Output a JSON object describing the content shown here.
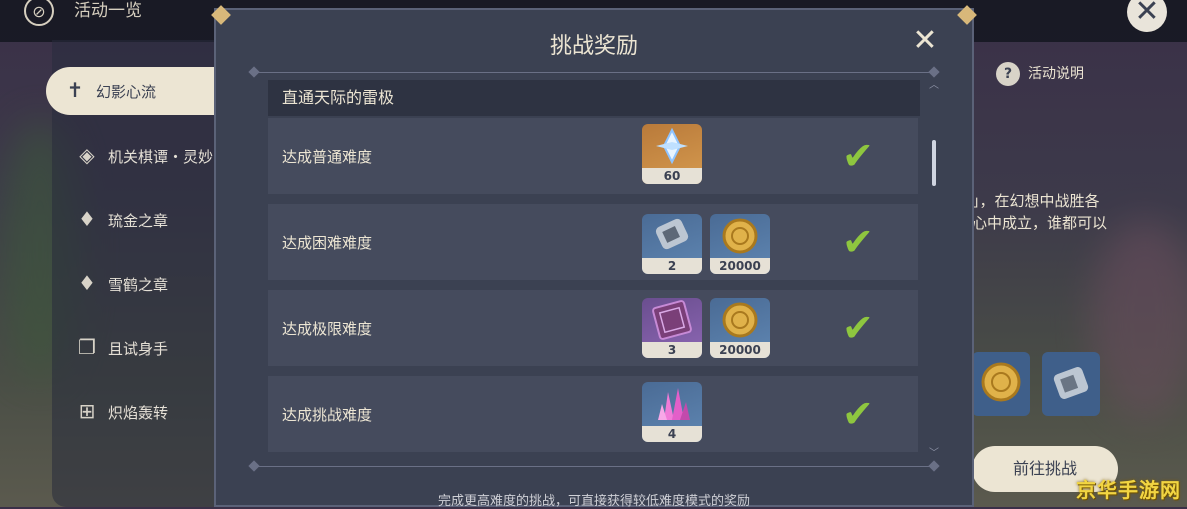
{
  "header": {
    "title": "活动一览"
  },
  "sidebar": {
    "items": [
      {
        "label": "幻影心流",
        "icon": "dancer-icon",
        "active": true
      },
      {
        "label": "机关棋谭・灵妙",
        "icon": "diamond-icon",
        "active": false
      },
      {
        "label": "琉金之章",
        "icon": "key-icon",
        "active": false
      },
      {
        "label": "雪鹤之章",
        "icon": "key-icon",
        "active": false
      },
      {
        "label": "且试身手",
        "icon": "cards-icon",
        "active": false
      },
      {
        "label": "炽焰轰转",
        "icon": "grid-icon",
        "active": false
      }
    ]
  },
  "right_panel": {
    "help_label": "活动说明",
    "desc_line1": "」，在幻想中战胜各",
    "desc_line2": "心中成立，谁都可以",
    "go_button": "前往挑战"
  },
  "dialog": {
    "title": "挑战奖励",
    "section_title": "直通天际的雷极",
    "rows": [
      {
        "label": "达成普通难度",
        "completed": true,
        "rewards": [
          {
            "icon": "primogem-icon",
            "count": "60",
            "bg": "gold"
          }
        ]
      },
      {
        "label": "达成困难难度",
        "completed": true,
        "rewards": [
          {
            "icon": "mystic-ore-icon",
            "count": "2",
            "bg": "blue"
          },
          {
            "icon": "mora-coin-icon",
            "count": "20000",
            "bg": "blue"
          }
        ]
      },
      {
        "label": "达成极限难度",
        "completed": true,
        "rewards": [
          {
            "icon": "talent-book-icon",
            "count": "3",
            "bg": "purple"
          },
          {
            "icon": "mora-coin-icon",
            "count": "20000",
            "bg": "blue"
          }
        ]
      },
      {
        "label": "达成挑战难度",
        "completed": true,
        "rewards": [
          {
            "icon": "crystal-icon",
            "count": "4",
            "bg": "blue"
          }
        ]
      }
    ],
    "footer_note": "完成更高难度的挑战，可直接获得较低难度模式的奖励"
  },
  "watermark": "京华手游网",
  "colors": {
    "panel": "#3b4152",
    "row": "#454b5d",
    "check": "#8ec63f",
    "cream": "#ece5d3"
  }
}
